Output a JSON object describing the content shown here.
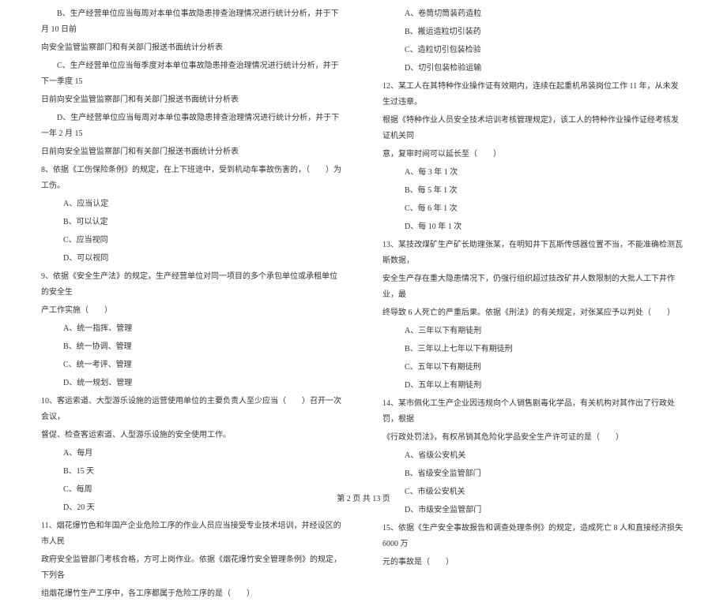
{
  "left": {
    "l1": "B、生产经营单位应当每周对本单位事故隐患排查治理情况进行统计分析，并于下月 10 日前",
    "l2": "向安全监管监察部门和有关部门报送书面统计分析表",
    "l3": "C、生产经营单位应当每季度对本单位事故隐患排查治理情况进行统计分析，并于下一季度 15",
    "l4": "日前向安全监管监察部门和有关部门报送书面统计分析表",
    "l5": "D、生产经营单位应当每周对本单位事故隐患排查治理情况进行统计分析，并于下一年 2 月 15",
    "l6": "日前向安全监管监察部门和有关部门报送书面统计分析表",
    "q8": "8、依据《工伤保险条例》的规定，在上下班途中，受到机动车事故伤害的，（　　）为工伤。",
    "q8a": "A、应当认定",
    "q8b": "B、可以认定",
    "q8c": "C、应当视同",
    "q8d": "D、可以视同",
    "q9": "9、依据《安全生产法》的规定，生产经营单位对同一项目的多个承包单位或承租单位的安全生",
    "q9_2": "产工作实施（　　）",
    "q9a": "A、统一指挥、管理",
    "q9b": "B、统一协调、管理",
    "q9c": "C、统一考评、管理",
    "q9d": "D、统一规划、管理",
    "q10": "10、客运索道、大型游乐设施的运营使用单位的主要负责人至少应当（　　）召开一次会议，",
    "q10_2": "督促、检查客运索道、人型游乐设施的安全使用工作。",
    "q10a": "A、每月",
    "q10b": "B、15 天",
    "q10c": "C、每周",
    "q10d": "D、20 天",
    "q11": "11、烟花爆竹色和年国产企业危险工序的作业人员应当接受专业技术培训，并经设区的市人民",
    "q11_2": "政府安全监管部门考核合格，方可上岗作业。依据《烟花爆竹安全管理条例》的规定，下列各",
    "q11_3": "组烟花爆竹生产工序中，各工序都属于危险工序的是（　　）"
  },
  "right": {
    "r1": "A、卷筒切筒装药造粒",
    "r2": "B、搬运造粒切引装药",
    "r3": "C、造粒切引包装检验",
    "r4": "D、切引包装检验运输",
    "q12": "12、某工人在其特种作业操作证有效期内，连续在起重机吊装岗位工作 11 年，从未发生过违章。",
    "q12_2": "根据《特种作业人员安全技术培训考核管理规定》，该工人的特种作业操作证经考核发证机关同",
    "q12_3": "意，复审时间可以延长至（　　）",
    "q12a": "A、每 3 年 1 次",
    "q12b": "B、每 5 年 1 次",
    "q12c": "C、每 6 年 1 次",
    "q12d": "D、每 10 年 1 次",
    "q13": "13、某技改煤矿生产矿长助理张某，在明知井下瓦斯传感器位置不当，不能准确检测瓦斯数据，",
    "q13_2": "安全生产存在重大隐患情况下，仍强行组织超过技改矿井人数限制的大批人工下井作业，最",
    "q13_3": "终导致 6 人死亡的严重后果。依据《刑法》的有关规定，对张某应予以判处（　　）",
    "q13a": "A、三年以下有期徒刑",
    "q13b": "B、三年以上七年以下有期徒刑",
    "q13c": "C、五年以下有期徒刑",
    "q13d": "D、五年以上有期徒刑",
    "q14": "14、某市佩化工生产企业因违规向个人销售剧毒化学品，有关机构对其作出了行政处罚，根据",
    "q14_2": "《行政处罚法》，有权吊销其危险化学品安全生产许可证的是（　　）",
    "q14a": "A、省级公安机关",
    "q14b": "B、省级安全监管部门",
    "q14c": "C、市级公安机关",
    "q14d": "D、市级安全监管部门",
    "q15": "15、依据《生产安全事故报告和调查处理条例》的规定，造成死亡 8 人和直接经济损失 6000 万",
    "q15_2": "元的事故是（　　）"
  },
  "footer": "第 2 页 共 13 页"
}
